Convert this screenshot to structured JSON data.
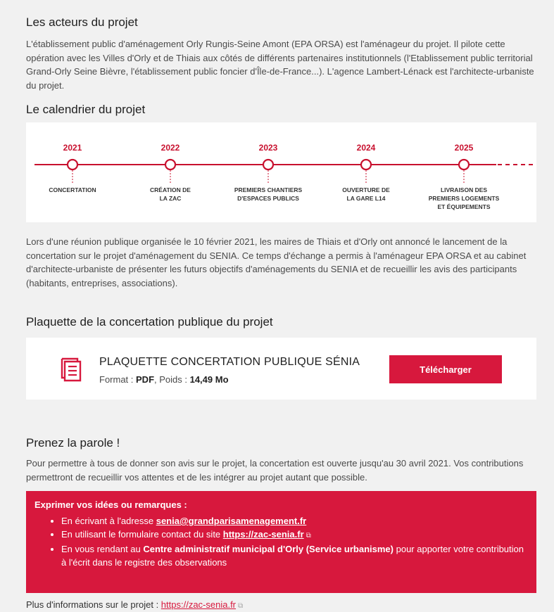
{
  "sections": {
    "actors_title": "Les acteurs du projet",
    "actors_text": "L'établissement public d'aménagement Orly Rungis-Seine Amont (EPA ORSA) est l'aménageur du projet. Il pilote cette opération avec les Villes d'Orly et de Thiais aux côtés de différents partenaires institutionnels (l'Etablissement public territorial Grand-Orly Seine Bièvre, l'établissement public foncier d'Île-de-France...). L'agence Lambert-Lénack est l'architecte-urbaniste du projet.",
    "calendar_title": "Le calendrier du projet",
    "meeting_text": "Lors d'une réunion publique organisée le 10 février 2021, les maires de Thiais et d'Orly ont annoncé le lancement de la concertation sur le projet d'aménagement du SENIA. Ce temps d'échange a permis à l'aménageur EPA ORSA et au cabinet d'architecte-urbaniste de présenter les futurs objectifs d'aménagements du SENIA et de recueillir les avis des participants (habitants, entreprises, associations).",
    "brochure_title": "Plaquette de la concertation publique du projet",
    "speak_title": "Prenez la parole !",
    "speak_text": "Pour permettre à tous de donner son avis sur le projet, la concertation est ouverte jusqu'au 30 avril 2021. Vos contributions permettront de recueillir vos attentes et de les intégrer au projet autant que possible."
  },
  "timeline": [
    {
      "year": "2021",
      "lines": [
        "CONCERTATION"
      ]
    },
    {
      "year": "2022",
      "lines": [
        "CRÉATION DE",
        "LA ZAC"
      ]
    },
    {
      "year": "2023",
      "lines": [
        "PREMIERS CHANTIERS",
        "D'ESPACES PUBLICS"
      ]
    },
    {
      "year": "2024",
      "lines": [
        "OUVERTURE DE",
        "LA GARE L14"
      ]
    },
    {
      "year": "2025",
      "lines": [
        "LIVRAISON DES",
        "PREMIERS LOGEMENTS",
        "ET ÉQUIPEMENTS"
      ]
    }
  ],
  "card": {
    "title": "PLAQUETTE CONCERTATION PUBLIQUE SÉNIA",
    "format_label": "Format : ",
    "format_value": "PDF",
    "size_label": ", Poids : ",
    "size_value": "14,49 Mo",
    "button_label": "Télécharger",
    "icon": "document-icon"
  },
  "contribute": {
    "title": "Exprimer vos idées ou remarques :",
    "item1_prefix": "En écrivant à l'adresse ",
    "item1_email": "senia@grandparisamenagement.fr",
    "item2_prefix": "En utilisant le formulaire contact du site ",
    "item2_link": "https://zac-senia.fr",
    "item3_prefix": "En vous rendant au ",
    "item3_bold": "Centre administratif municipal d'Orly (Service urbanisme)",
    "item3_suffix": " pour apporter votre contribution à l'écrit dans le registre des observations"
  },
  "footer": {
    "label": "Plus d'informations sur le projet : ",
    "link": "https://zac-senia.fr"
  },
  "colors": {
    "accent": "#d7183d",
    "timeline": "#c8102e",
    "background": "#f1f1f1"
  }
}
